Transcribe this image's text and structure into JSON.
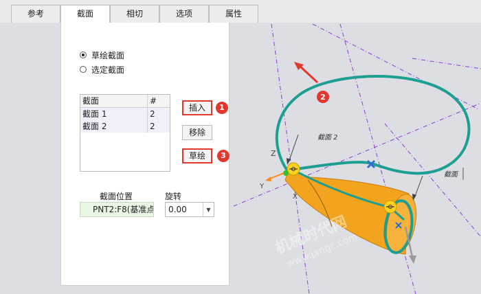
{
  "tabs": [
    {
      "label": "参考"
    },
    {
      "label": "截面"
    },
    {
      "label": "相切"
    },
    {
      "label": "选项"
    },
    {
      "label": "属性"
    }
  ],
  "active_tab": "截面",
  "panel": {
    "radio_sketch": "草绘截面",
    "radio_selected": "选定截面",
    "list": {
      "col_section": "截面",
      "col_count": "#",
      "rows": [
        {
          "section": "截面 1",
          "count": "2"
        },
        {
          "section": "截面 2",
          "count": "2"
        }
      ]
    },
    "btn_insert": "插入",
    "btn_remove": "移除",
    "btn_sketch": "草绘",
    "section_position_label": "截面位置",
    "section_position_value": "PNT2:F8(基准点",
    "rotation_label": "旋转",
    "rotation_value": "0.00"
  },
  "callouts": [
    "1",
    "2",
    "3"
  ],
  "viewport": {
    "label_section_2": "截面 2",
    "label_section_right": "截面",
    "axis_z": "Z",
    "axis_y": "Y",
    "axis_x": "X",
    "watermark_cn": "机械时代网",
    "watermark_url": "www.jxngc.com"
  },
  "colors": {
    "accent_red": "#e2372f",
    "curve_teal": "#1c9e93",
    "body_orange": "#f2a41e",
    "datum_purple": "#8a3fd1",
    "marker_blue": "#2c6fd6"
  }
}
